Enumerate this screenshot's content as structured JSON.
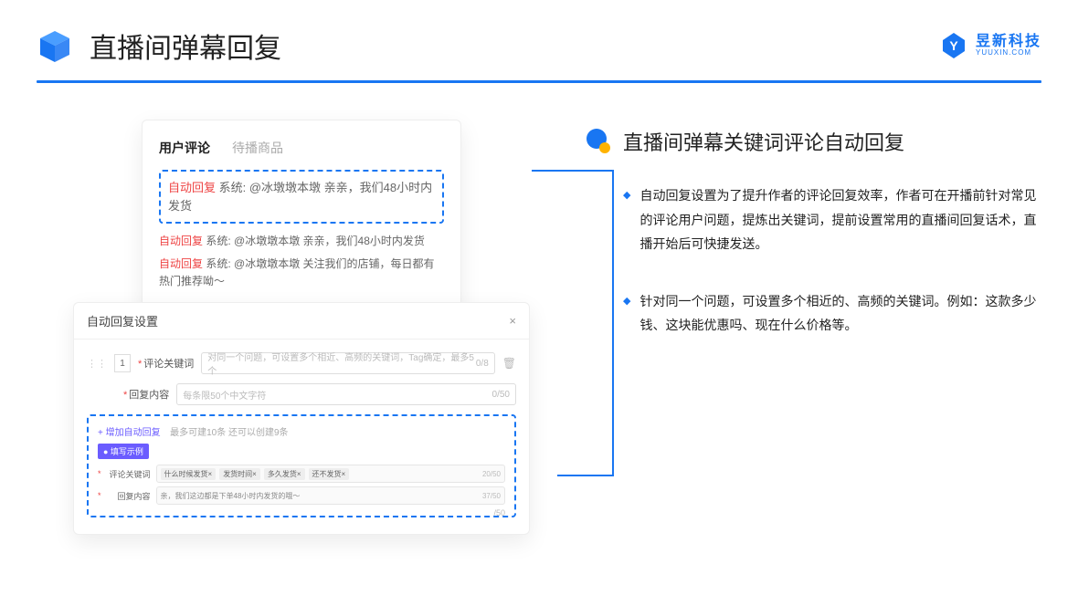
{
  "header": {
    "title": "直播间弹幕回复",
    "logo_cn": "昱新科技",
    "logo_en": "YUUXIN.COM"
  },
  "card_top": {
    "tab_active": "用户评论",
    "tab_inactive": "待播商品",
    "highlighted": {
      "tag": "自动回复",
      "text": " 系统: @冰墩墩本墩 亲亲，我们48小时内发货"
    },
    "rows": [
      {
        "tag": "自动回复",
        "text": " 系统: @冰墩墩本墩 亲亲，我们48小时内发货"
      },
      {
        "tag": "自动回复",
        "text": " 系统: @冰墩墩本墩 关注我们的店铺，每日都有热门推荐呦～"
      }
    ]
  },
  "modal": {
    "title": "自动回复设置",
    "order": "1",
    "kw_label": "评论关键词",
    "kw_placeholder": "对同一个问题，可设置多个相近、高频的关键词，Tag确定，最多5个",
    "kw_count": "0/8",
    "content_label": "回复内容",
    "content_placeholder": "每条限50个中文字符",
    "content_count": "0/50",
    "add_link": "+ 增加自动回复",
    "add_hint": "最多可建10条 还可以创建9条",
    "example_badge": "● 填写示例",
    "ex_kw_label": "评论关键词",
    "ex_tags": [
      "什么时候发货×",
      "发货时间×",
      "多久发货×",
      "还不发货×"
    ],
    "ex_kw_count": "20/50",
    "ex_content_label": "回复内容",
    "ex_content_text": "亲，我们这边都是下单48小时内发货的哦～",
    "ex_content_count": "37/50",
    "outside_count": "/50"
  },
  "right": {
    "subtitle": "直播间弹幕关键词评论自动回复",
    "bullets": [
      "自动回复设置为了提升作者的评论回复效率，作者可在开播前针对常见的评论用户问题，提炼出关键词，提前设置常用的直播间回复话术，直播开始后可快捷发送。",
      "针对同一个问题，可设置多个相近的、高频的关键词。例如：这款多少钱、这块能优惠吗、现在什么价格等。"
    ]
  }
}
